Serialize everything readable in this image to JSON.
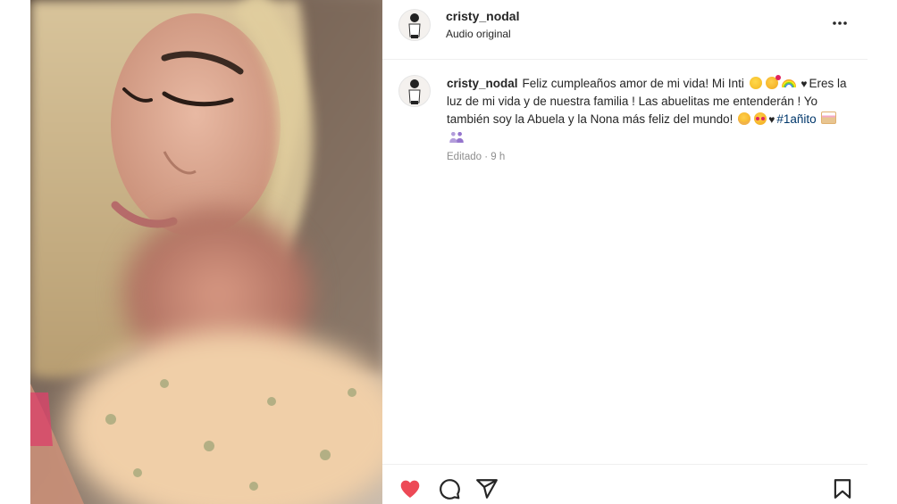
{
  "post": {
    "username": "cristy_nodal",
    "audio_label": "Audio original"
  },
  "caption": {
    "username": "cristy_nodal",
    "line1": "Feliz cumpleaños amor de mi vida! Mi Inti",
    "line2": "Eres la luz de mi vida y de nuestra familia ! Las abuelitas me entenderán ! Yo también soy la Abuela y la Nona más feliz del mundo!",
    "hashtag": "#1añito",
    "timestamp": "Editado · 9 h"
  },
  "icons": {
    "more": "more-horizontal-icon",
    "like": "heart-filled-icon",
    "comment": "comment-icon",
    "share": "send-icon",
    "save": "bookmark-icon"
  },
  "colors": {
    "like_red": "#ed4956",
    "hashtag_blue": "#00376b",
    "muted_text": "#8e8e8e"
  }
}
